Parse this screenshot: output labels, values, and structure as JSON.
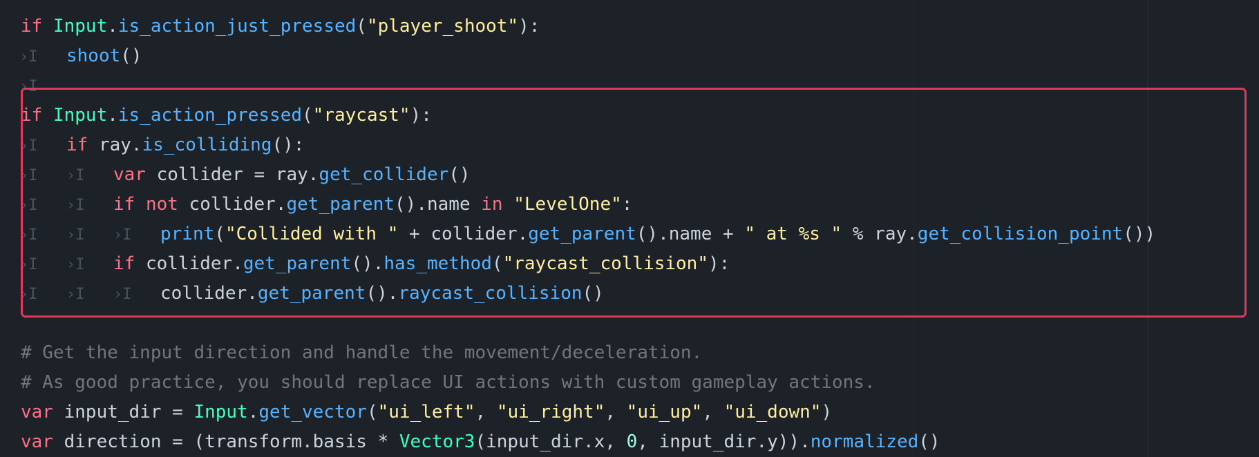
{
  "editor": {
    "colors": {
      "background": "#1d2229",
      "keyword": "#ff7085",
      "class": "#42ffc2",
      "function": "#57b3ff",
      "string": "#ffeda1",
      "text": "#cdd3dc",
      "comment": "#a3a9b3",
      "indent_glyph": "#4a525e",
      "highlight_border": "#e0395d"
    },
    "indent_glyph": "›I",
    "lines": [
      {
        "indent": 0,
        "tokens": [
          {
            "t": "kw",
            "v": "if"
          },
          {
            "t": "txt",
            "v": " "
          },
          {
            "t": "cls",
            "v": "Input"
          },
          {
            "t": "txt",
            "v": "."
          },
          {
            "t": "fn",
            "v": "is_action_just_pressed"
          },
          {
            "t": "txt",
            "v": "("
          },
          {
            "t": "str",
            "v": "\"player_shoot\""
          },
          {
            "t": "txt",
            "v": "):"
          }
        ]
      },
      {
        "indent": 1,
        "tokens": [
          {
            "t": "fn",
            "v": "shoot"
          },
          {
            "t": "txt",
            "v": "()"
          }
        ]
      },
      {
        "indent": 1,
        "tokens": []
      },
      {
        "indent": 0,
        "tokens": [
          {
            "t": "kw",
            "v": "if"
          },
          {
            "t": "txt",
            "v": " "
          },
          {
            "t": "cls",
            "v": "Input"
          },
          {
            "t": "txt",
            "v": "."
          },
          {
            "t": "fn",
            "v": "is_action_pressed"
          },
          {
            "t": "txt",
            "v": "("
          },
          {
            "t": "str",
            "v": "\"raycast\""
          },
          {
            "t": "txt",
            "v": "):"
          }
        ]
      },
      {
        "indent": 1,
        "tokens": [
          {
            "t": "kw",
            "v": "if"
          },
          {
            "t": "txt",
            "v": " ray."
          },
          {
            "t": "fn",
            "v": "is_colliding"
          },
          {
            "t": "txt",
            "v": "():"
          }
        ]
      },
      {
        "indent": 2,
        "tokens": [
          {
            "t": "kw",
            "v": "var"
          },
          {
            "t": "txt",
            "v": " collider = ray."
          },
          {
            "t": "fn",
            "v": "get_collider"
          },
          {
            "t": "txt",
            "v": "()"
          }
        ]
      },
      {
        "indent": 2,
        "tokens": [
          {
            "t": "kw",
            "v": "if"
          },
          {
            "t": "txt",
            "v": " "
          },
          {
            "t": "kw",
            "v": "not"
          },
          {
            "t": "txt",
            "v": " collider."
          },
          {
            "t": "fn",
            "v": "get_parent"
          },
          {
            "t": "txt",
            "v": "().name "
          },
          {
            "t": "kw",
            "v": "in"
          },
          {
            "t": "txt",
            "v": " "
          },
          {
            "t": "str",
            "v": "\"LevelOne\""
          },
          {
            "t": "txt",
            "v": ":"
          }
        ]
      },
      {
        "indent": 3,
        "tokens": [
          {
            "t": "fn",
            "v": "print"
          },
          {
            "t": "txt",
            "v": "("
          },
          {
            "t": "str",
            "v": "\"Collided with \""
          },
          {
            "t": "txt",
            "v": " + collider."
          },
          {
            "t": "fn",
            "v": "get_parent"
          },
          {
            "t": "txt",
            "v": "().name + "
          },
          {
            "t": "str",
            "v": "\" at %s \""
          },
          {
            "t": "txt",
            "v": " % ray."
          },
          {
            "t": "fn",
            "v": "get_collision_point"
          },
          {
            "t": "txt",
            "v": "())"
          }
        ]
      },
      {
        "indent": 2,
        "tokens": [
          {
            "t": "kw",
            "v": "if"
          },
          {
            "t": "txt",
            "v": " collider."
          },
          {
            "t": "fn",
            "v": "get_parent"
          },
          {
            "t": "txt",
            "v": "()."
          },
          {
            "t": "fn",
            "v": "has_method"
          },
          {
            "t": "txt",
            "v": "("
          },
          {
            "t": "str",
            "v": "\"raycast_collision\""
          },
          {
            "t": "txt",
            "v": "):"
          }
        ]
      },
      {
        "indent": 3,
        "tokens": [
          {
            "t": "txt",
            "v": "collider."
          },
          {
            "t": "fn",
            "v": "get_parent"
          },
          {
            "t": "txt",
            "v": "()."
          },
          {
            "t": "fn",
            "v": "raycast_collision"
          },
          {
            "t": "txt",
            "v": "()"
          }
        ]
      },
      {
        "indent": 0,
        "tokens": []
      },
      {
        "indent": 0,
        "tokens": [
          {
            "t": "cmt",
            "v": "# Get the input direction and handle the movement/deceleration."
          }
        ]
      },
      {
        "indent": 0,
        "tokens": [
          {
            "t": "cmt",
            "v": "# As good practice, you should replace UI actions with custom gameplay actions."
          }
        ]
      },
      {
        "indent": 0,
        "tokens": [
          {
            "t": "kw",
            "v": "var"
          },
          {
            "t": "txt",
            "v": " input_dir = "
          },
          {
            "t": "cls",
            "v": "Input"
          },
          {
            "t": "txt",
            "v": "."
          },
          {
            "t": "fn",
            "v": "get_vector"
          },
          {
            "t": "txt",
            "v": "("
          },
          {
            "t": "str",
            "v": "\"ui_left\""
          },
          {
            "t": "txt",
            "v": ", "
          },
          {
            "t": "str",
            "v": "\"ui_right\""
          },
          {
            "t": "txt",
            "v": ", "
          },
          {
            "t": "str",
            "v": "\"ui_up\""
          },
          {
            "t": "txt",
            "v": ", "
          },
          {
            "t": "str",
            "v": "\"ui_down\""
          },
          {
            "t": "txt",
            "v": ")"
          }
        ]
      },
      {
        "indent": 0,
        "tokens": [
          {
            "t": "kw",
            "v": "var"
          },
          {
            "t": "txt",
            "v": " direction = (transform.basis * "
          },
          {
            "t": "cls",
            "v": "Vector3"
          },
          {
            "t": "txt",
            "v": "(input_dir.x, "
          },
          {
            "t": "num",
            "v": "0"
          },
          {
            "t": "txt",
            "v": ", input_dir.y))."
          },
          {
            "t": "fn",
            "v": "normalized"
          },
          {
            "t": "txt",
            "v": "()"
          }
        ]
      }
    ]
  }
}
